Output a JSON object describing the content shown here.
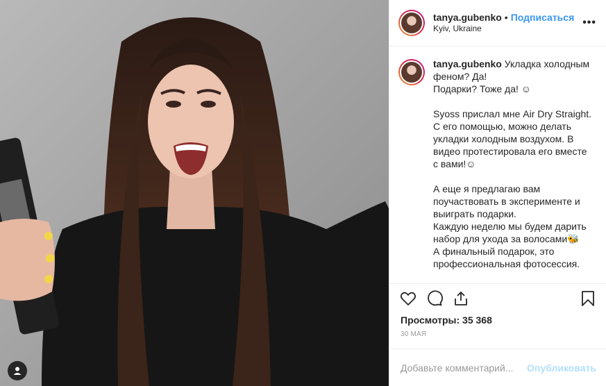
{
  "header": {
    "username": "tanya.gubenko",
    "separator": "•",
    "follow_label": "Подписаться",
    "location": "Kyiv, Ukraine",
    "more_icon": "more-icon",
    "more_label": "•••"
  },
  "caption": {
    "username": "tanya.gubenko",
    "text": "Укладка холодным феном? Да!\nПодарки? Тоже да! ☺\n\nSyoss прислал мне Air Dry Straight. С его помощью, можно делать укладки холодным воздухом. В видео протестировала его вместе с вами!☺\n\nА еще я предлагаю вам поучаствовать в эксперименте и выиграть подарки.\nКаждую неделю мы будем дарить набор для ухода за волосами🐝\nА финальный подарок, это профессиональная фотосессия.\n\nПравила максимально простые:\n•Выставляете фото или видео с вашими красивыми волосами"
  },
  "actions": {
    "like_icon": "heart-icon",
    "comment_icon": "comment-icon",
    "share_icon": "share-icon",
    "save_icon": "bookmark-icon"
  },
  "views": "Просмотры: 35 368",
  "date": "30 МАЯ",
  "add_comment": {
    "placeholder": "Добавьте комментарий...",
    "publish_label": "Опубликовать"
  },
  "colors": {
    "accent": "#3897f0",
    "publish_disabled": "#b2dffc",
    "text": "#262626",
    "muted": "#999999"
  }
}
